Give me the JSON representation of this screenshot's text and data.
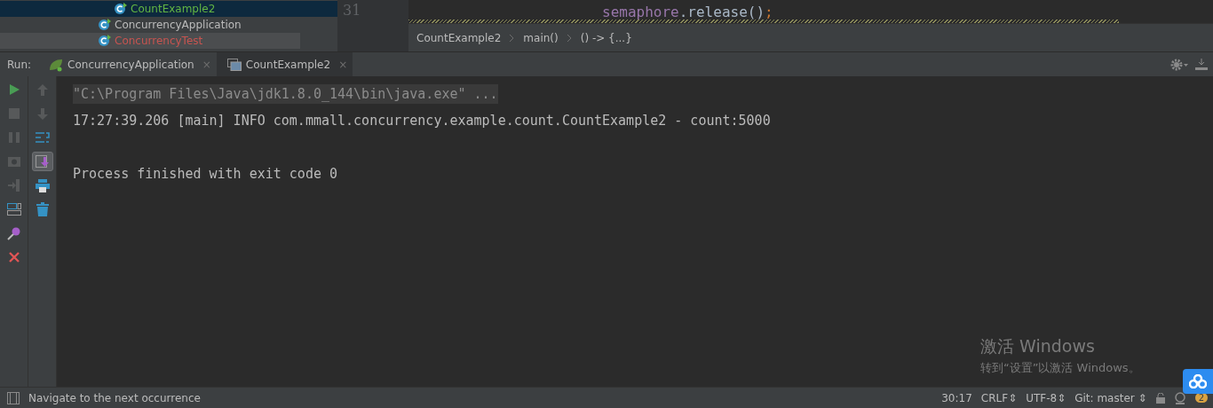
{
  "project_tree": {
    "items": [
      {
        "label": "CountExample2",
        "selected": true,
        "kind": "class"
      },
      {
        "label": "ConcurrencyApplication",
        "selected": false,
        "kind": "app"
      },
      {
        "label": "ConcurrencyTest",
        "selected": false,
        "kind": "test"
      }
    ]
  },
  "editor": {
    "line_number": "31",
    "code": [
      {
        "text": "semaphore",
        "kind": "field"
      },
      {
        "text": ".",
        "kind": "plain"
      },
      {
        "text": "release",
        "kind": "plain"
      },
      {
        "text": "()",
        "kind": "plain"
      },
      {
        "text": ";",
        "kind": "punct"
      }
    ]
  },
  "breadcrumbs": [
    "CountExample2",
    "main()",
    "() -> {...}"
  ],
  "run_panel": {
    "label": "Run:",
    "tabs": [
      {
        "label": "ConcurrencyApplication",
        "selected": false,
        "kind": "app",
        "close": "×"
      },
      {
        "label": "CountExample2",
        "selected": true,
        "kind": "console",
        "close": "×"
      }
    ],
    "left_toolbar": [
      {
        "kind": "run",
        "disabled": false
      },
      {
        "kind": "stop",
        "disabled": true
      },
      {
        "kind": "pause",
        "disabled": true
      },
      {
        "kind": "camera",
        "disabled": true
      },
      {
        "kind": "exit",
        "disabled": true
      },
      {
        "kind": "layout",
        "disabled": false
      },
      {
        "kind": "pin",
        "disabled": false
      },
      {
        "kind": "close",
        "disabled": false
      }
    ],
    "right_toolbar": [
      {
        "kind": "up",
        "disabled": true,
        "selected": false
      },
      {
        "kind": "down",
        "disabled": true,
        "selected": false
      },
      {
        "kind": "wrap",
        "disabled": false,
        "selected": false
      },
      {
        "kind": "scroll",
        "disabled": false,
        "selected": true
      },
      {
        "kind": "print",
        "disabled": false,
        "selected": false
      },
      {
        "kind": "trash",
        "disabled": false,
        "selected": false
      }
    ],
    "console": [
      {
        "text": "\"C:\\Program Files\\Java\\jdk1.8.0_144\\bin\\java.exe\" ...",
        "kind": "command"
      },
      {
        "text": "17:27:39.206 [main] INFO com.mmall.concurrency.example.count.CountExample2 - count:5000",
        "kind": "output"
      },
      {
        "kind": "blank"
      },
      {
        "text": "Process finished with exit code 0",
        "kind": "output"
      }
    ]
  },
  "activation_notice": {
    "title": "激活 Windows",
    "subtitle": "转到“设置”以激活 Windows。"
  },
  "status_bar": {
    "message": "Navigate to the next occurrence",
    "position": "30:17",
    "line_separator": "CRLF⇕",
    "encoding": "UTF-8⇕",
    "vcs": "Git: master ⇕",
    "notifications": "2"
  }
}
